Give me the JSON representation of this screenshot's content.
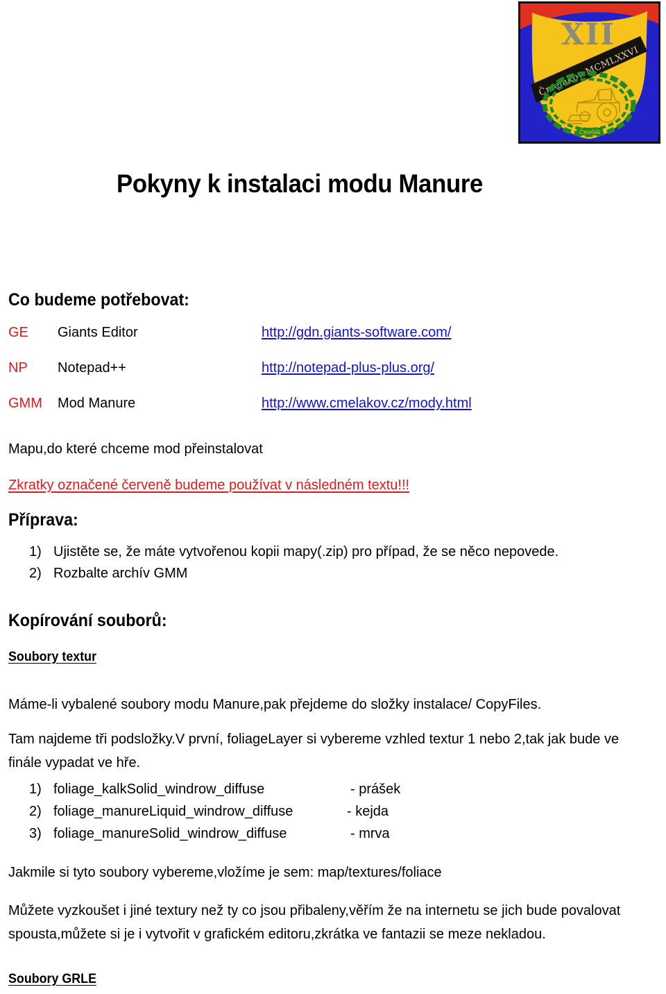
{
  "emblem": {
    "name": "crest-emblem",
    "roman_numeral": "XII",
    "banner_text": "Čmelákov MCMLXXVI",
    "ribbon_text": "Čmelák",
    "colors": {
      "background_blue": "#2222c8",
      "top_red": "#e03020",
      "shield_gold": "#f5c319",
      "wreath_green": "#1f8a24",
      "numeral_gray": "#8a8a80"
    }
  },
  "document": {
    "title": "Pokyny k instalaci modu Manure"
  },
  "needs": {
    "heading": "Co budeme potřebovat:",
    "rows": [
      {
        "abbr": "GE",
        "name": "Giants Editor",
        "url": "http://gdn.giants-software.com/"
      },
      {
        "abbr": "NP",
        "name": "Notepad++",
        "url": "http://notepad-plus-plus.org/"
      },
      {
        "abbr": "GMM",
        "name": "Mod Manure",
        "url": "http://www.cmelakov.cz/mody.html"
      }
    ],
    "map_line": "Mapu,do které chceme mod přeinstalovat",
    "note_red": "Zkratky označené červeně budeme používat v následném textu!!!"
  },
  "preparation": {
    "heading": "Příprava:",
    "items": [
      {
        "num": "1)",
        "text": "Ujistěte se, že máte vytvořenou kopii mapy(.zip) pro případ, že se něco nepovede."
      },
      {
        "num": "2)",
        "text": "Rozbalte archív GMM"
      }
    ]
  },
  "copying": {
    "heading": "Kopírování souborů:",
    "textures_heading": "Soubory textur",
    "para_mame": "Máme-li vybalené soubory modu Manure,pak přejdeme do složky instalace/ CopyFiles.",
    "para_tam": "Tam najdeme tři podsložky.V první, foliageLayer si vybereme vzhled textur 1 nebo 2,tak jak bude ve finále vypadat ve hře.",
    "foliage_items": [
      {
        "num": "1)",
        "file": "foliage_kalkSolid_windrow_diffuse",
        "desc": "-  prášek"
      },
      {
        "num": "2)",
        "file": "foliage_manureLiquid_windrow_diffuse",
        "desc": "- kejda"
      },
      {
        "num": "3)",
        "file": "foliage_manureSolid_windrow_diffuse",
        "desc": "- mrva"
      }
    ],
    "para_jakmile": "Jakmile si tyto soubory vybereme,vložíme je sem: map/textures/foliace",
    "para_muzete": "Můžete vyzkoušet i jiné textury než ty co jsou přibaleny,věřím že na internetu se jich bude povalovat spousta,můžete si je i vytvořit v grafickém editoru,zkrátka ve fantazii se meze nekladou.",
    "grle_heading": "Soubory GRLE"
  },
  "colors": {
    "red": "#e01b1b",
    "link_blue": "#1313cf",
    "text": "#000000"
  }
}
